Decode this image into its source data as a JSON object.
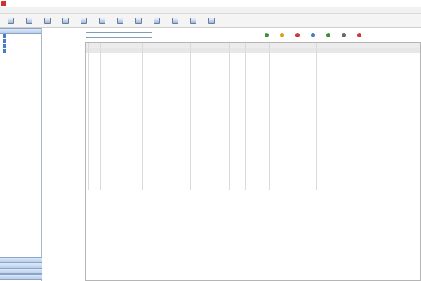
{
  "window": {
    "title": ""
  },
  "menubar": {
    "items": [
      "",
      "",
      "",
      "",
      "",
      "",
      ""
    ]
  },
  "toolbar": {
    "buttons": [
      "",
      "",
      "",
      "",
      "",
      "",
      "",
      "",
      "",
      "",
      "",
      ""
    ]
  },
  "left_panel": {
    "header": "",
    "items": [
      "",
      "",
      "",
      ""
    ],
    "bottom_items": [
      "",
      "",
      "",
      ""
    ]
  },
  "search": {
    "label": "",
    "value": ""
  },
  "actions": {
    "buttons": [
      "",
      "",
      "",
      "",
      "",
      "",
      ""
    ]
  },
  "tree": {
    "nodes": [
      "",
      "",
      "",
      "",
      "",
      "",
      "",
      "",
      "",
      "",
      "",
      "",
      "",
      "",
      "",
      "",
      "",
      "",
      "",
      "",
      "",
      "",
      "",
      "",
      ""
    ]
  },
  "grid": {
    "columns": [
      "",
      "",
      "",
      "",
      "",
      "",
      "",
      "",
      "",
      "",
      "",
      "",
      ""
    ],
    "rows": [
      [
        "",
        "",
        "",
        "",
        "",
        "",
        "",
        "",
        "",
        "",
        "",
        "",
        ""
      ],
      [
        "",
        "",
        "",
        "",
        "",
        "",
        "",
        "",
        "",
        "",
        "",
        "",
        ""
      ],
      [
        "",
        "",
        "",
        "",
        "",
        "",
        "",
        "",
        "",
        "",
        "",
        "",
        ""
      ],
      [
        "",
        "",
        "",
        "",
        "",
        "",
        "",
        "",
        "",
        "",
        "",
        "",
        ""
      ],
      [
        "",
        "",
        "",
        "",
        "",
        "",
        "",
        "",
        "",
        "",
        "",
        "",
        ""
      ],
      [
        "",
        "",
        "",
        "",
        "",
        "",
        "",
        "",
        "",
        "",
        "",
        "",
        ""
      ],
      [
        "",
        "",
        "",
        "",
        "",
        "",
        "",
        "",
        "",
        "",
        "",
        "",
        ""
      ],
      [
        "",
        "",
        "",
        "",
        "",
        "",
        "",
        "",
        "",
        "",
        "",
        "",
        ""
      ],
      [
        "",
        "",
        "",
        "",
        "",
        "",
        "",
        "",
        "",
        "",
        "",
        "",
        ""
      ],
      [
        "",
        "",
        "",
        "",
        "",
        "",
        "",
        "",
        "",
        "",
        "",
        "",
        ""
      ],
      [
        "",
        "",
        "",
        "",
        "",
        "",
        "",
        "",
        "",
        "",
        "",
        "",
        ""
      ],
      [
        "",
        "",
        "",
        "",
        "",
        "",
        "",
        "",
        "",
        "",
        "",
        "",
        ""
      ],
      [
        "",
        "",
        "",
        "",
        "",
        "",
        "",
        "",
        "",
        "",
        "",
        "",
        ""
      ],
      [
        "",
        "",
        "",
        "",
        "",
        "",
        "",
        "",
        "",
        "",
        "",
        "",
        ""
      ],
      [
        "",
        "",
        "",
        "",
        "",
        "",
        "",
        "",
        "",
        "",
        "",
        "",
        ""
      ],
      [
        "",
        "",
        "",
        "",
        "",
        "",
        "",
        "",
        "",
        "",
        "",
        "",
        ""
      ],
      [
        "",
        "",
        "",
        "",
        "",
        "",
        "",
        "",
        "",
        "",
        "",
        "",
        ""
      ],
      [
        "",
        "",
        "",
        "",
        "",
        "",
        "",
        "",
        "",
        "",
        "",
        "",
        ""
      ],
      [
        "",
        "",
        "",
        "",
        "",
        "",
        "",
        "",
        "",
        "",
        "",
        "",
        ""
      ],
      [
        "",
        "",
        "",
        "",
        "",
        "",
        "",
        "",
        "",
        "",
        "",
        "",
        ""
      ],
      [
        "",
        "",
        "",
        "",
        "",
        "",
        "",
        "",
        "",
        "",
        "",
        "",
        ""
      ],
      [
        "",
        "",
        "",
        "",
        "",
        "",
        "",
        "",
        "",
        "",
        "",
        "",
        ""
      ],
      [
        "",
        "",
        "",
        "",
        "",
        "",
        "",
        "",
        "",
        "",
        "",
        "",
        ""
      ],
      [
        "",
        "",
        "",
        "",
        "",
        "",
        "",
        "",
        "",
        "",
        "",
        "",
        ""
      ],
      [
        "",
        "",
        "",
        "",
        "",
        "",
        "",
        "",
        "",
        "",
        "",
        "",
        ""
      ],
      [
        "",
        "",
        "",
        "",
        "",
        "",
        "",
        "",
        "",
        "",
        "",
        "",
        ""
      ],
      [
        "",
        "",
        "",
        "",
        "",
        "",
        "",
        "",
        "",
        "",
        "",
        "",
        ""
      ],
      [
        "",
        "",
        "",
        "",
        "",
        "",
        "",
        "",
        "",
        "",
        "",
        "",
        ""
      ],
      [
        "",
        "",
        "",
        "",
        "",
        "",
        "",
        "",
        "",
        "",
        "",
        "",
        ""
      ],
      [
        "",
        "",
        "",
        "",
        "",
        "",
        "",
        "",
        "",
        "",
        "",
        "",
        ""
      ],
      [
        "",
        "",
        "",
        "",
        "",
        "",
        "",
        "",
        "",
        "",
        "",
        "",
        ""
      ],
      [
        "",
        "",
        "",
        "",
        "",
        "",
        "",
        "",
        "",
        "",
        "",
        "",
        ""
      ],
      [
        "",
        "",
        "",
        "",
        "",
        "",
        "",
        "",
        "",
        "",
        "",
        "",
        ""
      ],
      [
        "",
        "",
        "",
        "",
        "",
        "",
        "",
        "",
        "",
        "",
        "",
        "",
        ""
      ],
      [
        "",
        "",
        "",
        "",
        "",
        "",
        "",
        "",
        "",
        "",
        "",
        "",
        ""
      ],
      [
        "",
        "",
        "",
        "",
        "",
        "",
        "",
        "",
        "",
        "",
        "",
        "",
        ""
      ]
    ],
    "selected_row": 0
  },
  "colors": {
    "accent": "#4a7cc7",
    "selection": "#e7e7e7",
    "app_icon": "#d2302c"
  },
  "icons": {
    "action_colors": [
      "#3b8e3b",
      "#d9a21b",
      "#c73b3b",
      "#4a7cc7",
      "#3b8e3b",
      "#6a6a6a",
      "#c73b3b"
    ]
  }
}
